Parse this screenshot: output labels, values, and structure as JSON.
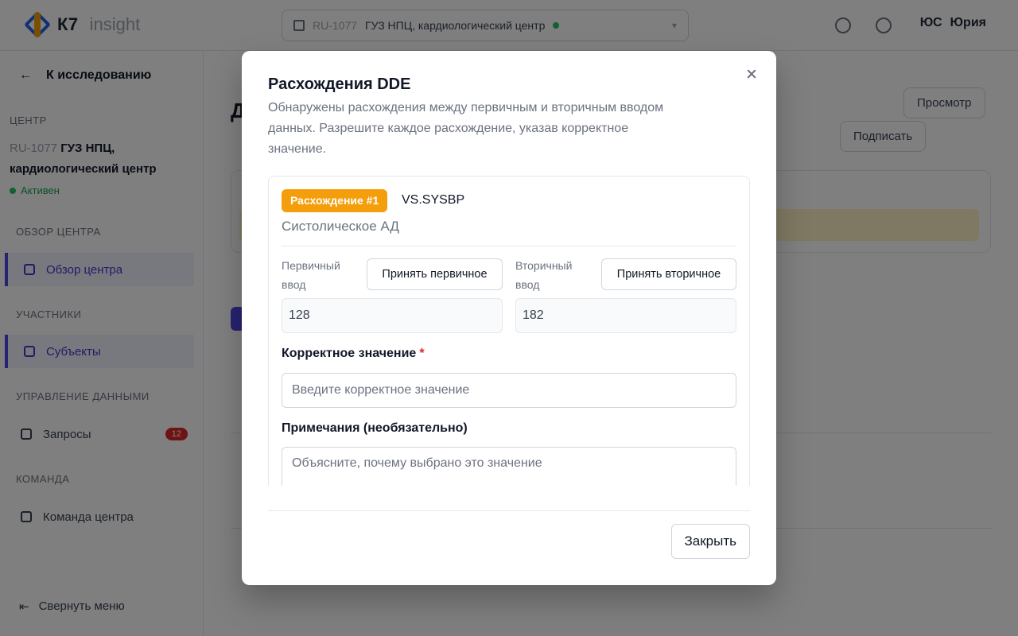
{
  "app": {
    "logo_text": "К7",
    "logo_sub": "insight",
    "site_code": "RU-1077",
    "site_name": "ГУЗ НПЦ, кардиологический центр",
    "user_initials": "ЮС",
    "user_name": "Юрия"
  },
  "sidebar": {
    "back_label": "К исследованию",
    "site_section": "ЦЕНТР",
    "site_code": "RU-1077",
    "site_name": "ГУЗ НПЦ, кардиологический центр",
    "site_status": "Активен",
    "sections": [
      {
        "title": "ОБЗОР ЦЕНТРА",
        "items": [
          {
            "label": "Обзор центра",
            "active": true
          }
        ]
      },
      {
        "title": "УЧАСТНИКИ",
        "items": [
          {
            "label": "Субъекты",
            "active": true
          }
        ]
      },
      {
        "title": "УПРАВЛЕНИЕ ДАННЫМИ",
        "items": [
          {
            "label": "Запросы",
            "badge": "12"
          }
        ]
      },
      {
        "title": "КОМАНДА",
        "items": [
          {
            "label": "Команда центра"
          }
        ]
      }
    ],
    "collapse_label": "Свернуть меню"
  },
  "background": {
    "preview_label": "Просмотр",
    "sign_label": "Подписать"
  },
  "modal": {
    "title": "Расхождения DDE",
    "description": "Обнаружены расхождения между первичным и вторичным вводом данных. Разрешите каждое расхождение, указав корректное значение.",
    "discrepancy": {
      "badge": "Расхождение #1",
      "variable_code": "VS.SYSBP",
      "variable_name": "Систолическое АД",
      "primary": {
        "label": "Первичный ввод",
        "accept_label": "Принять первичное",
        "value": "128"
      },
      "secondary": {
        "label": "Вторичный ввод",
        "accept_label": "Принять вторичное",
        "value": "182"
      },
      "correct_value": {
        "label": "Корректное значение",
        "required_mark": "*",
        "placeholder": "Введите корректное значение",
        "value": ""
      },
      "notes": {
        "label": "Примечания (необязательно)",
        "placeholder": "Объясните, почему выбрано это значение",
        "value": ""
      }
    },
    "close_label": "Закрыть"
  },
  "colors": {
    "badge": "#f59e0b",
    "required": "#dc2626",
    "accent": "#4f46e5",
    "overlay": "rgba(0,0,0,0.5)"
  }
}
